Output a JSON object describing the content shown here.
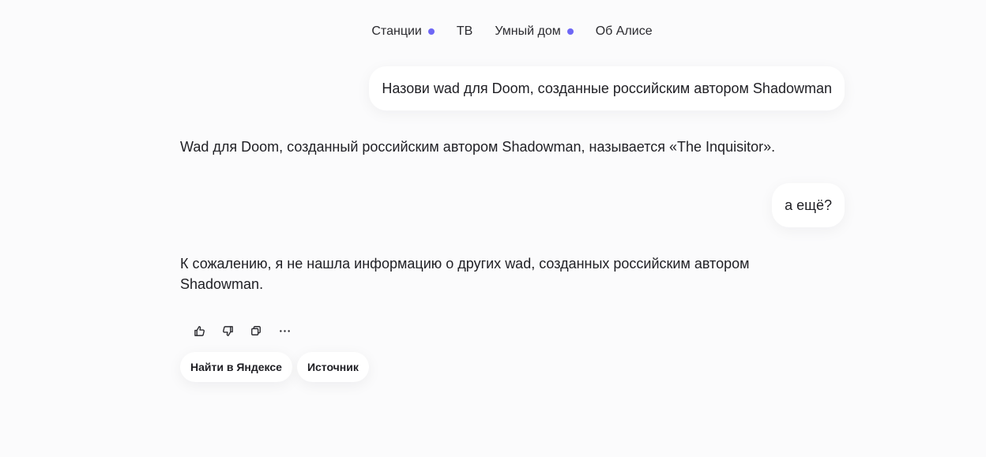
{
  "nav": {
    "items": [
      {
        "label": "Станции",
        "dot": true
      },
      {
        "label": "ТВ",
        "dot": false
      },
      {
        "label": "Умный дом",
        "dot": true
      },
      {
        "label": "Об Алисе",
        "dot": false
      }
    ],
    "dot_color": "#6e67f5"
  },
  "chat": {
    "messages": [
      {
        "role": "user",
        "text": "Назови wad для Doom, созданные российским автором Shadowman"
      },
      {
        "role": "assistant",
        "text": "Wad для Doom, созданный российским автором Shadowman, называется «The Inquisitor»."
      },
      {
        "role": "user",
        "text": "а ещё?"
      },
      {
        "role": "assistant",
        "text": "К сожалению, я не нашла информацию о других wad, созданных российским автором Shadowman."
      }
    ]
  },
  "actions": {
    "icons": [
      "thumbs-up-icon",
      "thumbs-down-icon",
      "copy-icon",
      "more-icon"
    ]
  },
  "chips": {
    "search_label": "Найти в Яндексе",
    "source_label": "Источник"
  }
}
